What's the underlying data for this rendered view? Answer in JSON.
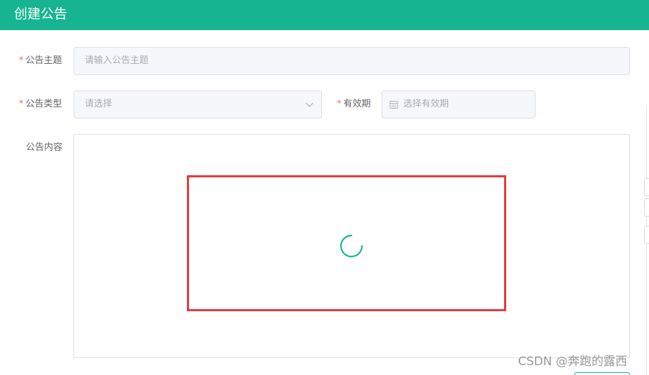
{
  "header": {
    "title": "创建公告"
  },
  "form": {
    "subject": {
      "label": "公告主题",
      "placeholder": "请输入公告主题",
      "required_mark": "*"
    },
    "type": {
      "label": "公告类型",
      "placeholder": "请选择",
      "required_mark": "*"
    },
    "validity": {
      "label": "有效期",
      "placeholder": "选择有效期",
      "required_mark": "*"
    },
    "content": {
      "label": "公告内容"
    }
  },
  "watermark": "CSDN @奔跑的露西",
  "colors": {
    "brand": "#17b491",
    "required": "#f56c6c",
    "highlight": "#e8383d"
  }
}
